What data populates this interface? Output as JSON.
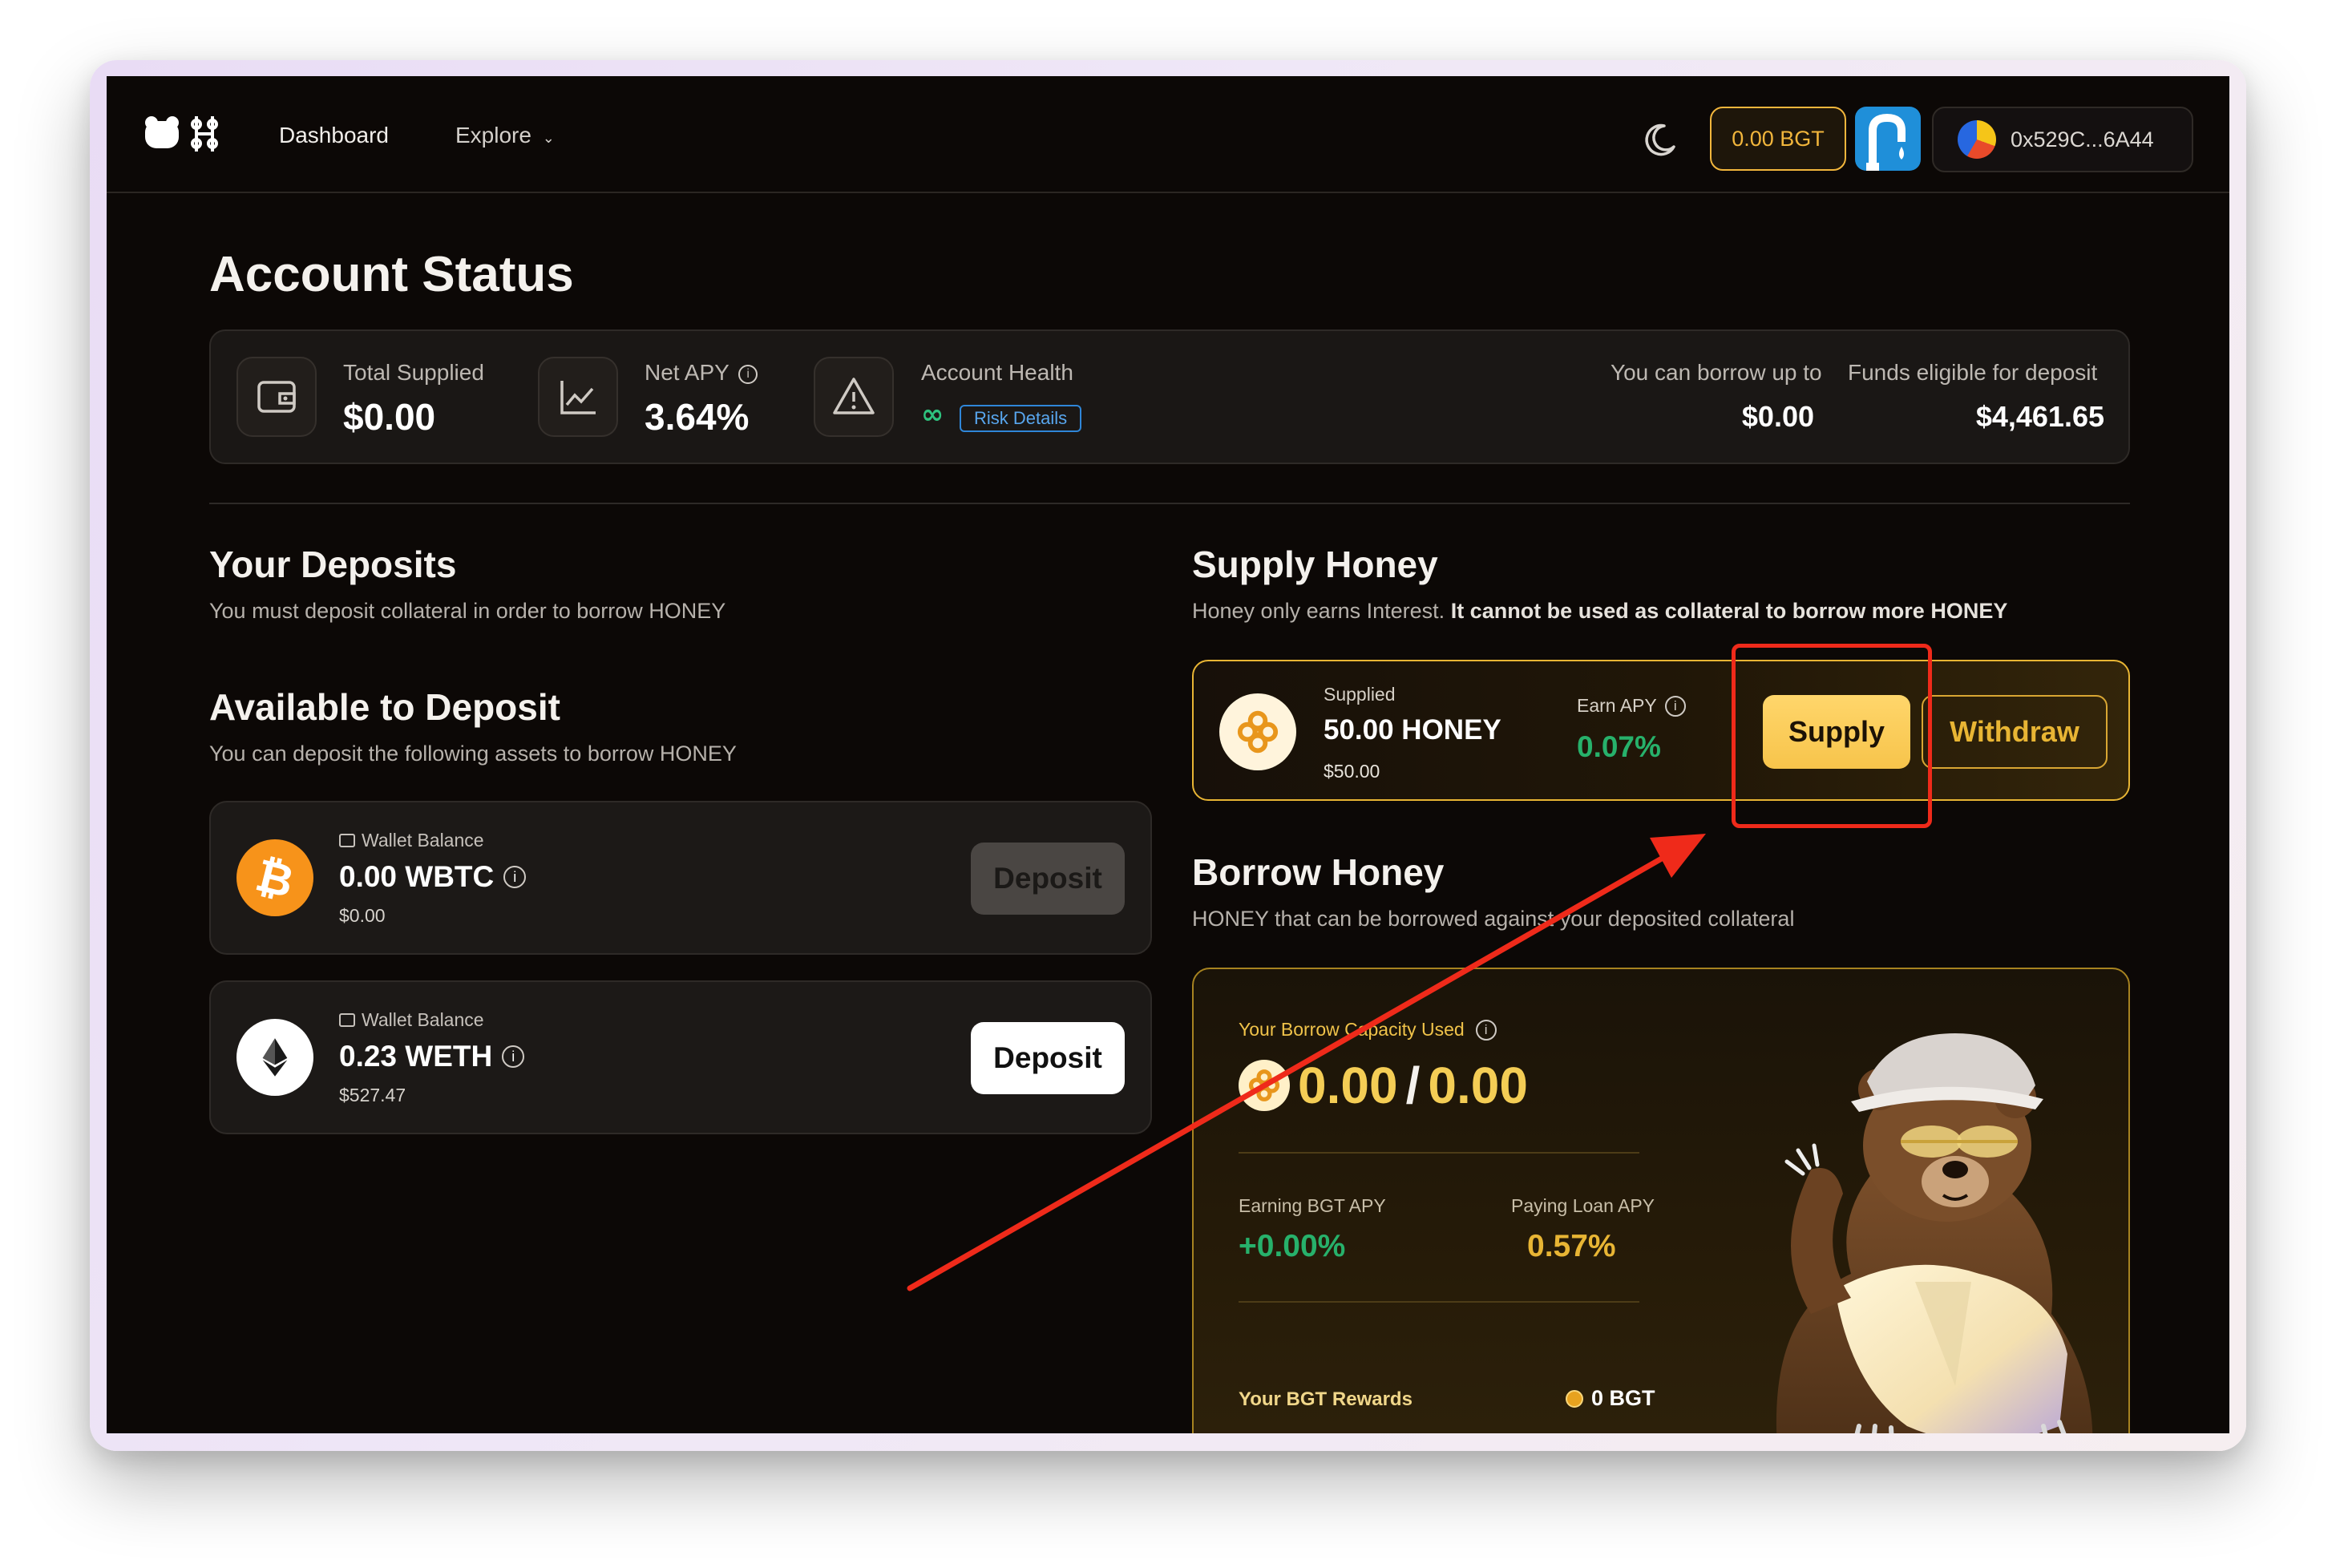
{
  "nav": {
    "dashboard_label": "Dashboard",
    "explore_label": "Explore",
    "bgt_balance": "0.00 BGT",
    "wallet_address": "0x529C...6A44"
  },
  "account_status": {
    "title": "Account Status",
    "total_supplied_label": "Total Supplied",
    "total_supplied_value": "$0.00",
    "net_apy_label": "Net APY",
    "net_apy_value": "3.64%",
    "account_health_label": "Account Health",
    "account_health_value": "∞",
    "risk_details_label": "Risk Details",
    "borrow_up_to_label": "You can borrow up to",
    "borrow_up_to_value": "$0.00",
    "funds_eligible_label": "Funds eligible for deposit",
    "funds_eligible_value": "$4,461.65"
  },
  "deposits": {
    "title": "Your Deposits",
    "subtitle": "You must deposit collateral in order to borrow HONEY"
  },
  "available": {
    "title": "Available to Deposit",
    "subtitle": "You can deposit the following assets to borrow HONEY",
    "assets": [
      {
        "wallet_label": "Wallet Balance",
        "amount": "0.00 WBTC",
        "usd": "$0.00",
        "button": "Deposit",
        "icon": "bitcoin-icon"
      },
      {
        "wallet_label": "Wallet Balance",
        "amount": "0.23 WETH",
        "usd": "$527.47",
        "button": "Deposit",
        "icon": "ethereum-icon"
      }
    ]
  },
  "supply": {
    "title": "Supply Honey",
    "subtitle_plain": "Honey only earns Interest.",
    "subtitle_bold": "It cannot be used as collateral to borrow more HONEY",
    "supplied_label": "Supplied",
    "supplied_amount": "50.00 HONEY",
    "supplied_usd": "$50.00",
    "earn_apy_label": "Earn APY",
    "earn_apy_value": "0.07%",
    "supply_button": "Supply",
    "withdraw_button": "Withdraw"
  },
  "borrow": {
    "title": "Borrow Honey",
    "subtitle": "HONEY that can be borrowed against your deposited collateral",
    "capacity_label": "Your Borrow Capacity Used",
    "capacity_used": "0.00",
    "capacity_separator": "/",
    "capacity_total": "0.00",
    "earning_label": "Earning BGT APY",
    "earning_value": "+0.00%",
    "paying_label": "Paying Loan APY",
    "paying_value": "0.57%",
    "rewards_label": "Your BGT Rewards",
    "rewards_value": "0 BGT"
  },
  "colors": {
    "accent_gold": "#f2b63c",
    "positive_green": "#27b16b",
    "annotation_red": "#ef2a1a",
    "background": "#0c0806"
  }
}
